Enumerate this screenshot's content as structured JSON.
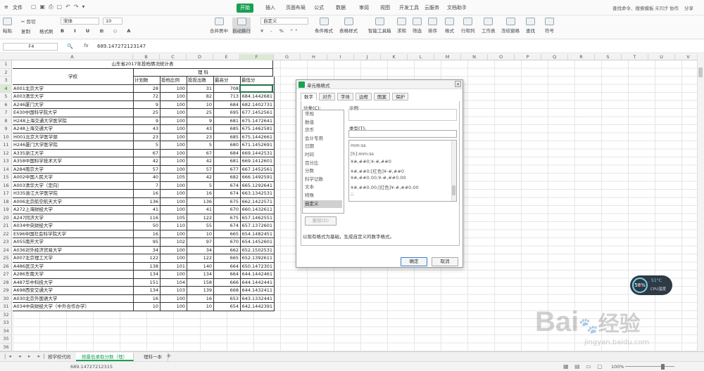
{
  "app": {
    "file_menu": "文件",
    "search": "查找命令、搜索模板",
    "not_synced": "未同步",
    "collab": "协作",
    "share": "分享"
  },
  "menu_tabs": [
    "开始",
    "插入",
    "页面布局",
    "公式",
    "数据",
    "审阅",
    "视图",
    "开发工具",
    "云服务",
    "文档助手"
  ],
  "ribbon": {
    "paste": "粘贴",
    "cut": "剪切",
    "copy": "复制",
    "format_painter": "格式刷",
    "font": "宋体",
    "size": "10",
    "merge": "合并居中",
    "wrap": "自动换行",
    "numfmt": "自定义",
    "cond": "条件格式",
    "table_style": "表格样式",
    "smart": "智能工具箱",
    "sum": "求和",
    "filter": "筛选",
    "sort": "排序",
    "format": "格式",
    "rowcol": "行和列",
    "sheet": "工作表",
    "freeze": "冻结窗格",
    "find": "查找",
    "symbol": "符号"
  },
  "formula": {
    "cell_ref": "F4",
    "fx": "fx",
    "value": "689.147272123147"
  },
  "columns": [
    "A",
    "B",
    "C",
    "D",
    "E",
    "F",
    "G",
    "H",
    "I",
    "J",
    "K",
    "L",
    "M",
    "N",
    "O",
    "P",
    "Q",
    "R",
    "S",
    "T",
    "U",
    "V",
    "W"
  ],
  "rows": [
    "1",
    "2",
    "3",
    "4",
    "5",
    "6",
    "7",
    "8",
    "9",
    "10",
    "11",
    "12",
    "13",
    "14",
    "15",
    "16",
    "17",
    "18",
    "19",
    "20",
    "21",
    "22",
    "23",
    "24",
    "25",
    "26",
    "27",
    "28",
    "29",
    "30",
    "31",
    "32",
    "33",
    "34",
    "35",
    "36"
  ],
  "sheet": {
    "title": "山东省2017年投档情况统计表",
    "hdr_school": "学校",
    "hdr_group": "理    科",
    "hdr_cols": [
      "计划数",
      "投档比例",
      "投投出数",
      "最高分",
      "最低分"
    ],
    "data": [
      [
        "A001北京大学",
        "28",
        "100",
        "31",
        "708",
        ""
      ],
      [
        "A003清华大学",
        "72",
        "100",
        "82",
        "713",
        "684.1442681"
      ],
      [
        "A246厦门大学",
        "9",
        "100",
        "10",
        "684",
        "682.1402731"
      ],
      [
        "E430中国科学院大学",
        "25",
        "100",
        "25",
        "695",
        "677.1452561"
      ],
      [
        "H248上海交通大学医学院",
        "9",
        "100",
        "9",
        "681",
        "675.1472641"
      ],
      [
        "A248上海交通大学",
        "43",
        "100",
        "43",
        "685",
        "675.1462581"
      ],
      [
        "H001北京大学医学部",
        "23",
        "100",
        "23",
        "685",
        "675.1442661"
      ],
      [
        "H246厦门大学医学院",
        "5",
        "100",
        "5",
        "680",
        "671.1452691"
      ],
      [
        "A335浙江大学",
        "67",
        "100",
        "67",
        "684",
        "669.1442531"
      ],
      [
        "A358中国科学技术大学",
        "42",
        "100",
        "42",
        "681",
        "669.1412601"
      ],
      [
        "A284南京大学",
        "57",
        "100",
        "57",
        "677",
        "667.1452561"
      ],
      [
        "A002中国人民大学",
        "40",
        "105",
        "42",
        "682",
        "666.1492591"
      ],
      [
        "A003清华大学（定向）",
        "7",
        "100",
        "5",
        "674",
        "665.1292641"
      ],
      [
        "H335浙江大学医学院",
        "16",
        "100",
        "16",
        "674",
        "663.1342531"
      ],
      [
        "A006北京航空航天大学",
        "136",
        "100",
        "136",
        "675",
        "662.1422571"
      ],
      [
        "A272上海财经大学",
        "41",
        "100",
        "41",
        "670",
        "660.1432611"
      ],
      [
        "A247同济大学",
        "116",
        "105",
        "122",
        "675",
        "657.1462551"
      ],
      [
        "A034中央财经大学",
        "50",
        "110",
        "55",
        "674",
        "657.1372601"
      ],
      [
        "E596中国社会科学院大学",
        "16",
        "100",
        "10",
        "665",
        "654.1482451"
      ],
      [
        "A055南开大学",
        "95",
        "102",
        "97",
        "670",
        "654.1452601"
      ],
      [
        "A036对外经济贸易大学",
        "34",
        "100",
        "34",
        "662",
        "652.1502531"
      ],
      [
        "A007北京理工大学",
        "122",
        "100",
        "122",
        "665",
        "652.1392611"
      ],
      [
        "A486武汉大学",
        "138",
        "101",
        "140",
        "664",
        "650.1472301"
      ],
      [
        "A286东南大学",
        "134",
        "100",
        "134",
        "664",
        "644.1442461"
      ],
      [
        "A487华中科技大学",
        "151",
        "104",
        "158",
        "666",
        "644.1442441"
      ],
      [
        "A698西安交通大学",
        "134",
        "103",
        "139",
        "668",
        "644.1432411"
      ],
      [
        "A030北京外国语大学",
        "16",
        "100",
        "16",
        "653",
        "643.1332441"
      ],
      [
        "A034中央财经大学（中外合作办学）",
        "10",
        "100",
        "10",
        "654",
        "642.1442391"
      ]
    ]
  },
  "dialog": {
    "title": "单元格格式",
    "tabs": [
      "数字",
      "对齐",
      "字体",
      "边框",
      "图案",
      "保护"
    ],
    "cat_label": "分类(C):",
    "categories": [
      "常规",
      "数值",
      "货币",
      "会计专用",
      "日期",
      "时间",
      "百分比",
      "分数",
      "科学记数",
      "文本",
      "特殊",
      "自定义"
    ],
    "sample_label": "示例",
    "type_label": "类型(T):",
    "formats": [
      "mm:ss",
      "[h]:mm:ss",
      "¥#,##0;¥-#,##0",
      "¥#,##0;[红色]¥-#,##0",
      "¥#,##0.00;¥-#,##0.00",
      "¥#,##0.00;[红色]¥-#,##0.00",
      ";;"
    ],
    "delete": "删除(D)",
    "desc": "以现有格式为基础，生成自定义的数字格式。",
    "ok": "确定",
    "cancel": "取消"
  },
  "sheet_tabs": [
    "按学校代码",
    "按最低录取分数（理）",
    "理科一本"
  ],
  "status": {
    "value": "689.14727212315",
    "zoom": "100%"
  },
  "widget": {
    "percent": "58%",
    "temp": "51°C",
    "label": "CPU温度"
  },
  "watermark": {
    "brand": "Bai",
    "brand2": "经验",
    "url": "jingyan.baidu.com"
  },
  "colors": {
    "accent": "#19a052",
    "selection": "#217346"
  }
}
